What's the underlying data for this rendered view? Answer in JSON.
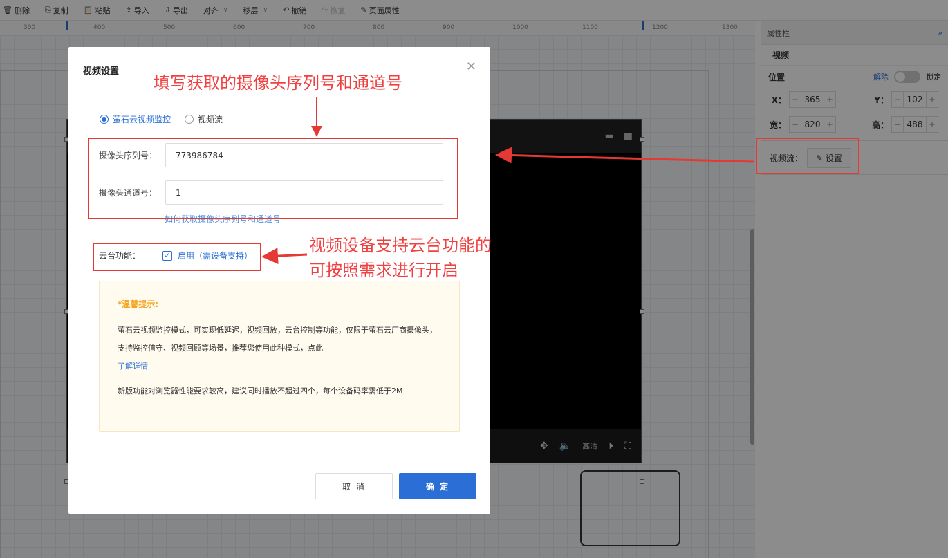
{
  "toolbar": {
    "items": [
      {
        "icon": "delete-icon",
        "glyph": "🗑",
        "label": "删除"
      },
      {
        "icon": "copy-icon",
        "glyph": "⎘",
        "label": "复制"
      },
      {
        "icon": "paste-icon",
        "glyph": "📋",
        "label": "粘贴"
      },
      {
        "icon": "import-icon",
        "glyph": "⇪",
        "label": "导入"
      },
      {
        "icon": "export-icon",
        "glyph": "⇩",
        "label": "导出"
      },
      {
        "icon": "",
        "glyph": "",
        "label": "对齐"
      },
      {
        "icon": "",
        "glyph": "",
        "label": "移层"
      },
      {
        "icon": "undo-icon",
        "glyph": "↶",
        "label": "撤销"
      },
      {
        "icon": "redo-icon",
        "glyph": "↷",
        "label": "恢复"
      },
      {
        "icon": "page-props-icon",
        "glyph": "✎",
        "label": "页面属性"
      }
    ]
  },
  "ruler": {
    "ticks": [
      "300",
      "400",
      "500",
      "600",
      "700",
      "800",
      "900",
      "1000",
      "1100",
      "1200",
      "1300"
    ]
  },
  "right_panel": {
    "header": "属性栏",
    "section": "视频",
    "position_label": "位置",
    "unlock_label": "解除",
    "lock_label": "锁定",
    "x_label": "X：",
    "x_value": "365",
    "y_label": "Y：",
    "y_value": "102",
    "w_label": "宽：",
    "w_value": "820",
    "h_label": "高：",
    "h_value": "488",
    "stream_label": "视频流：",
    "set_button": "设置"
  },
  "video_player": {
    "quality": "高清"
  },
  "modal": {
    "title": "视频设置",
    "mode_options": [
      "萤石云视频监控",
      "视频流"
    ],
    "selected_mode": "萤石云视频监控",
    "serial_label": "摄像头序列号：",
    "serial_value": "773986784",
    "channel_label": "摄像头通道号：",
    "channel_value": "1",
    "help_link": "如何获取摄像头序列号和通道号",
    "ptz_label": "云台功能：",
    "ptz_option": "启用（需设备支持）",
    "ptz_checked": true,
    "tips_title": "*温馨提示:",
    "tips_p1": "萤石云视频监控模式，可实现低延迟，视频回放，云台控制等功能，仅限于萤石云厂商摄像头，支持监控值守、视频回顾等场景，推荐您使用此种模式，点此",
    "tips_link": "了解详情",
    "tips_p2": "新版功能对浏览器性能要求较高，建议同时播放不超过四个，每个设备码率需低于2M",
    "cancel": "取 消",
    "ok": "确 定"
  },
  "annotations": {
    "top": "填写获取的摄像头序列号和通道号",
    "ptz_line1": "视频设备支持云台功能的",
    "ptz_line2": "可按照需求进行开启",
    "color": "#e53935"
  }
}
